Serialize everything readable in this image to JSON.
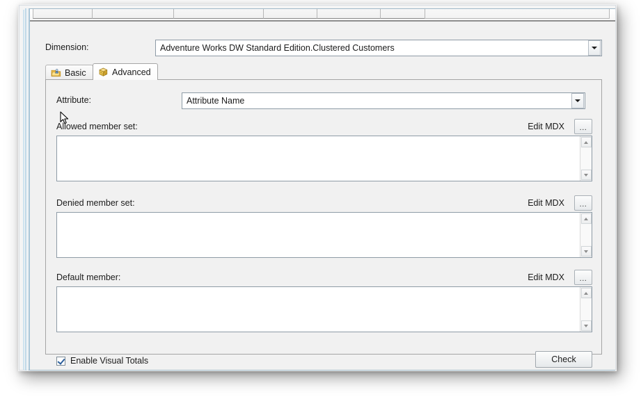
{
  "window": {
    "top_strip": {
      "tabs": [
        "",
        "",
        "",
        "",
        "",
        "",
        ""
      ],
      "ellipsis": "⋮"
    }
  },
  "dimension_row": {
    "label": "Dimension:",
    "value": "Adventure Works DW Standard Edition.Clustered Customers",
    "dropdown_icon": "chevron-down-icon"
  },
  "tabs": [
    {
      "label": "Basic",
      "icon": "dimension-folder-icon",
      "selected": false
    },
    {
      "label": "Advanced",
      "icon": "cube-icon",
      "selected": true
    }
  ],
  "advanced_page": {
    "attribute": {
      "label": "Attribute:",
      "value": "Attribute Name",
      "dropdown_icon": "chevron-down-icon"
    },
    "sections": [
      {
        "label": "Allowed member set:",
        "edit_mdx_label": "Edit MDX",
        "browse_button_label": "...",
        "value": "",
        "placeholder": ""
      },
      {
        "label": "Denied member set:",
        "edit_mdx_label": "Edit MDX",
        "browse_button_label": "...",
        "value": "",
        "placeholder": ""
      },
      {
        "label": "Default member:",
        "edit_mdx_label": "Edit MDX",
        "browse_button_label": "...",
        "value": "",
        "placeholder": ""
      }
    ],
    "footer": {
      "checkbox_label": "Enable Visual Totals",
      "checkbox_checked": true,
      "check_button_label": "Check"
    }
  },
  "colors": {
    "panel_background": "#f1f1f1",
    "field_background": "#ffffff",
    "field_border": "#8e9ba6",
    "accent_edge": "#bfd9e8",
    "text": "#1b1b1b",
    "checkmark": "#2b5e9b"
  }
}
